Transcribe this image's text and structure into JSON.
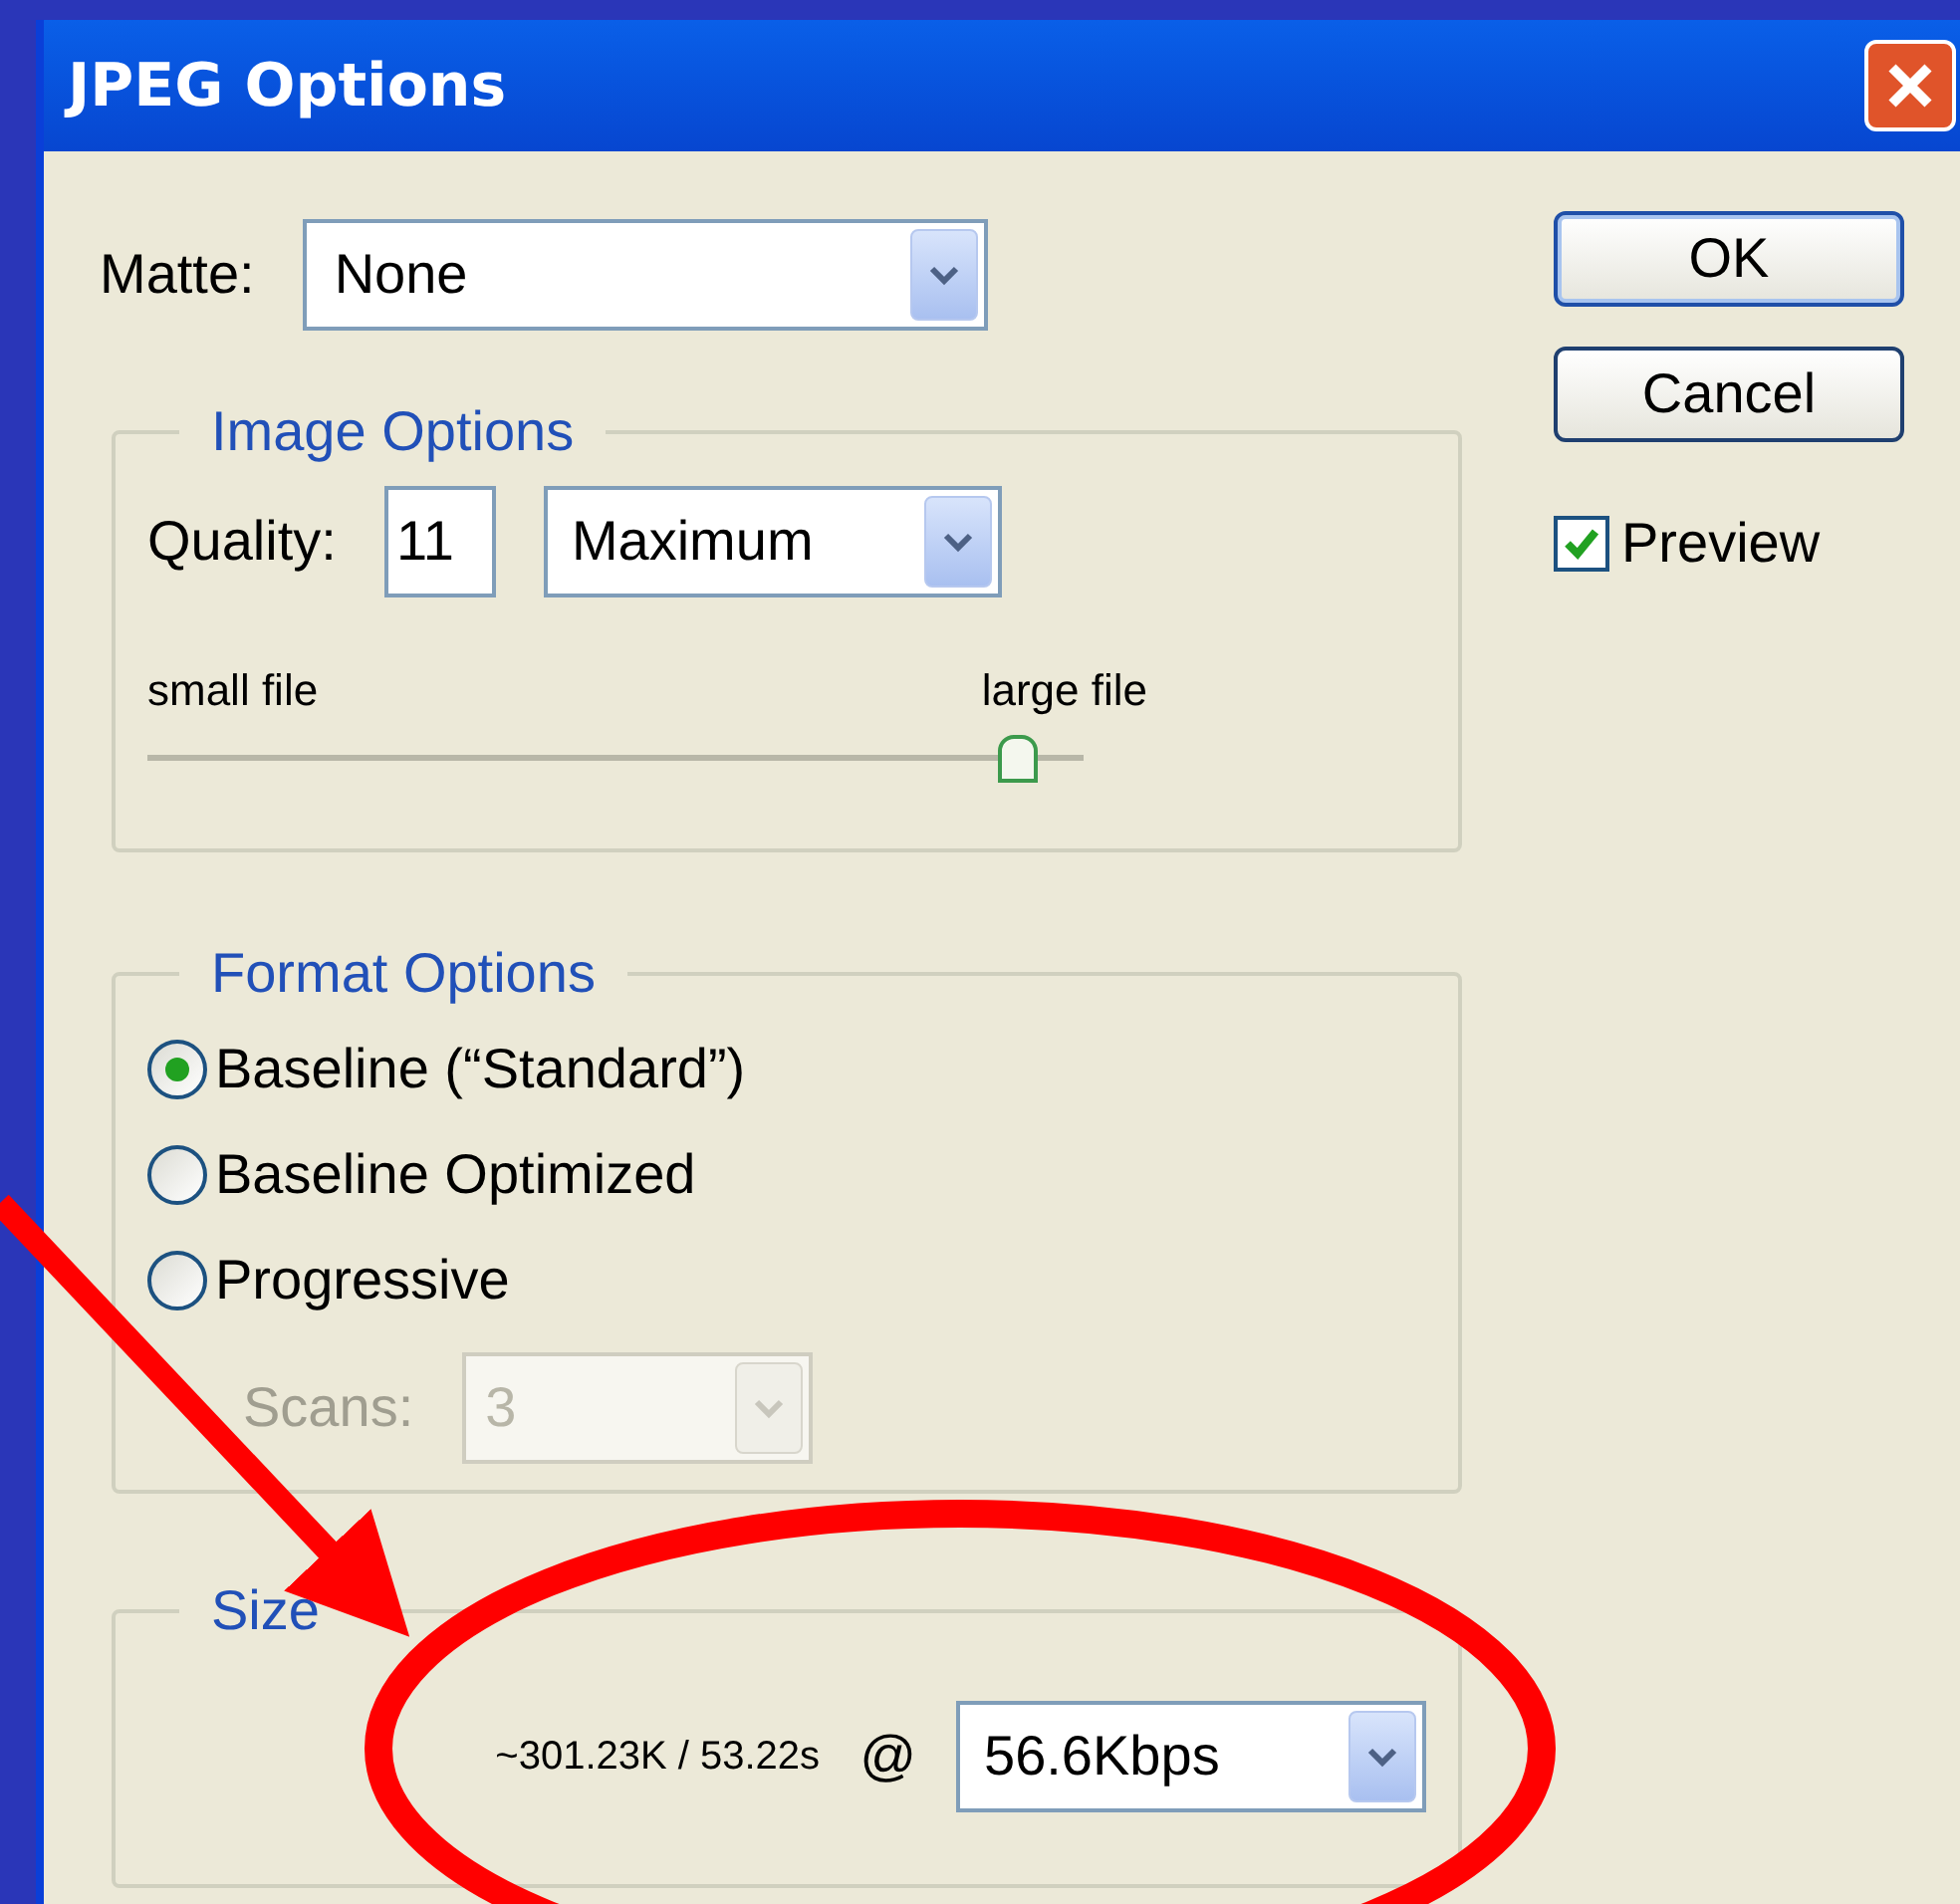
{
  "window": {
    "title": "JPEG Options"
  },
  "matte": {
    "label": "Matte:",
    "value": "None"
  },
  "image_options": {
    "title": "Image Options",
    "quality_label": "Quality:",
    "quality_value": "11",
    "quality_preset": "Maximum",
    "min_label": "small file",
    "max_label": "large file",
    "level": 0.93
  },
  "format_options": {
    "title": "Format Options",
    "options": [
      {
        "label": "Baseline (“Standard”)",
        "selected": true
      },
      {
        "label": "Baseline Optimized",
        "selected": false
      },
      {
        "label": "Progressive",
        "selected": false
      }
    ],
    "scans": {
      "label": "Scans:",
      "value": "3",
      "disabled": true
    }
  },
  "size": {
    "title": "Size",
    "estimate": "~301.23K / 53.22s",
    "at": "@",
    "speed": "56.6Kbps"
  },
  "buttons": [
    "OK",
    "Cancel"
  ],
  "preview": {
    "label": "Preview",
    "checked": true
  }
}
